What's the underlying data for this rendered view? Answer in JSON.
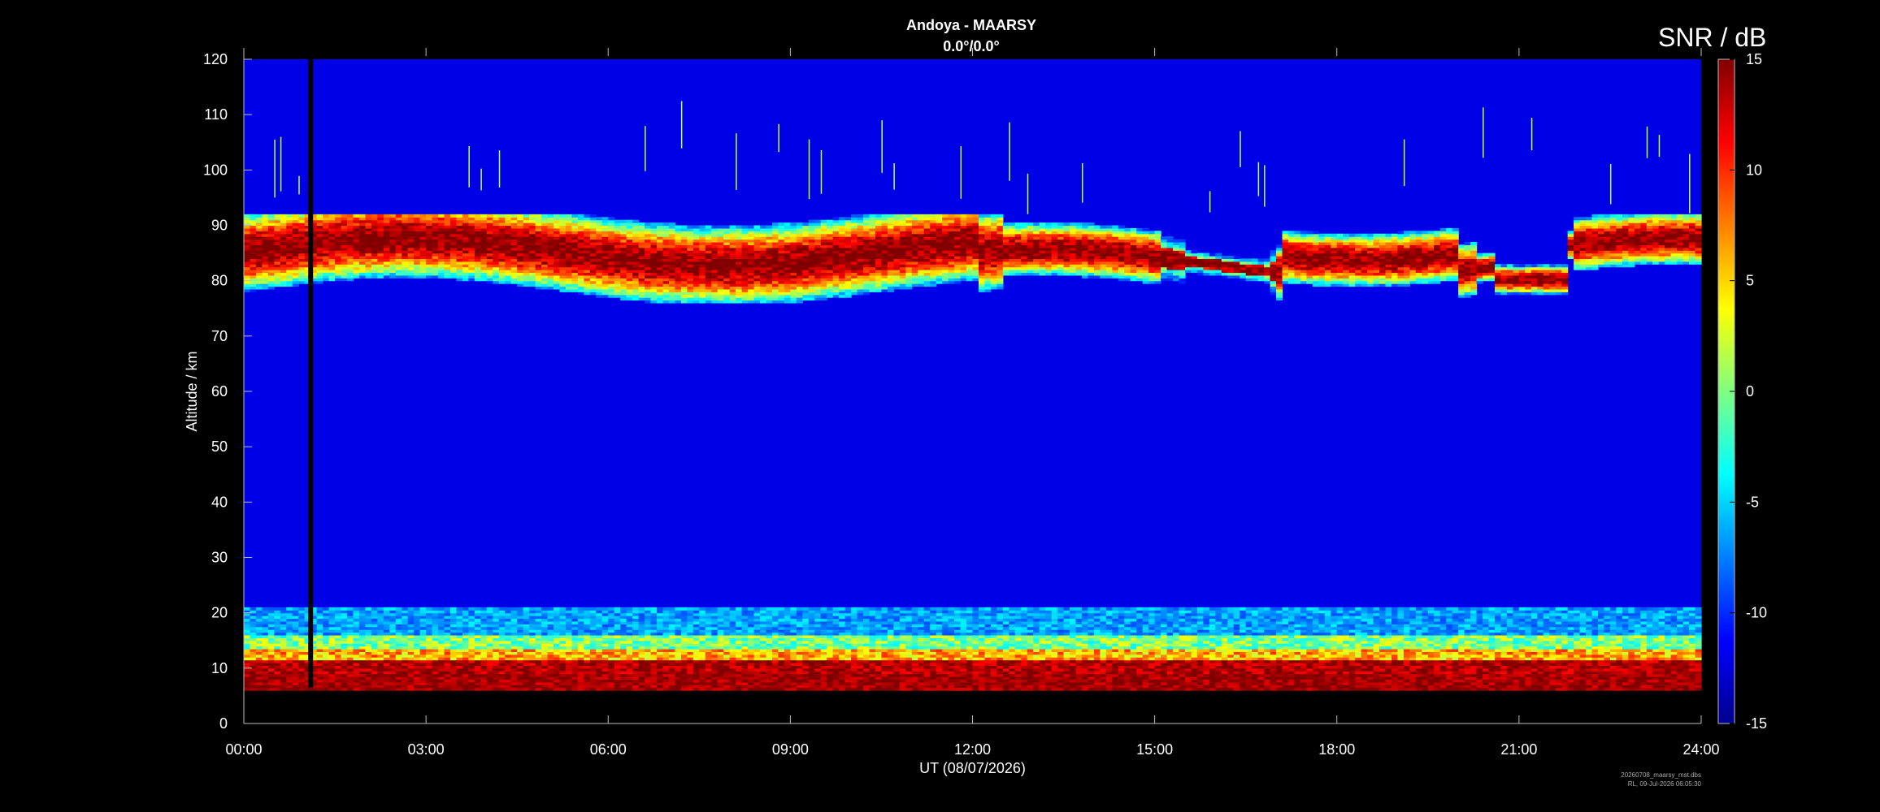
{
  "chart_data": {
    "type": "heatmap",
    "title": "Andoya - MAARSY",
    "subtitle": "0.0°/0.0°",
    "xlabel": "UT (08/07/2026)",
    "ylabel": "Altitude / km",
    "x_tick_labels": [
      "00:00",
      "03:00",
      "06:00",
      "09:00",
      "12:00",
      "15:00",
      "18:00",
      "21:00",
      "24:00"
    ],
    "xlim": [
      0,
      24
    ],
    "y_ticks": [
      0,
      10,
      20,
      30,
      40,
      50,
      60,
      70,
      80,
      90,
      100,
      110,
      120
    ],
    "ylim": [
      0,
      120
    ],
    "colorbar": {
      "label": "SNR / dB",
      "range": [
        -15,
        15
      ],
      "ticks": [
        -15,
        -10,
        -5,
        0,
        5,
        10,
        15
      ],
      "colormap": "jet"
    },
    "data_gap": {
      "time_h": 1.1,
      "note": "vertical black line of missing data"
    },
    "features": [
      {
        "name": "PMSE layer",
        "time_range_h": [
          0,
          24
        ],
        "altitude_km": [
          78,
          92
        ],
        "peak_snr_db": 15
      },
      {
        "name": "Tropospheric/ground echoes",
        "time_range_h": [
          0,
          24
        ],
        "altitude_km": [
          6,
          21
        ],
        "peak_snr_db": 15
      },
      {
        "name": "Meteor streaks",
        "time_range_h": [
          0,
          24
        ],
        "altitude_km": [
          90,
          116
        ]
      }
    ],
    "background_snr_db": -12,
    "no_data_below_km": 6.5
  },
  "footer": {
    "file": "20260708_maarsy_mst.dbs",
    "stamp": "RL, 09-Jul-2026 06:05:30"
  }
}
